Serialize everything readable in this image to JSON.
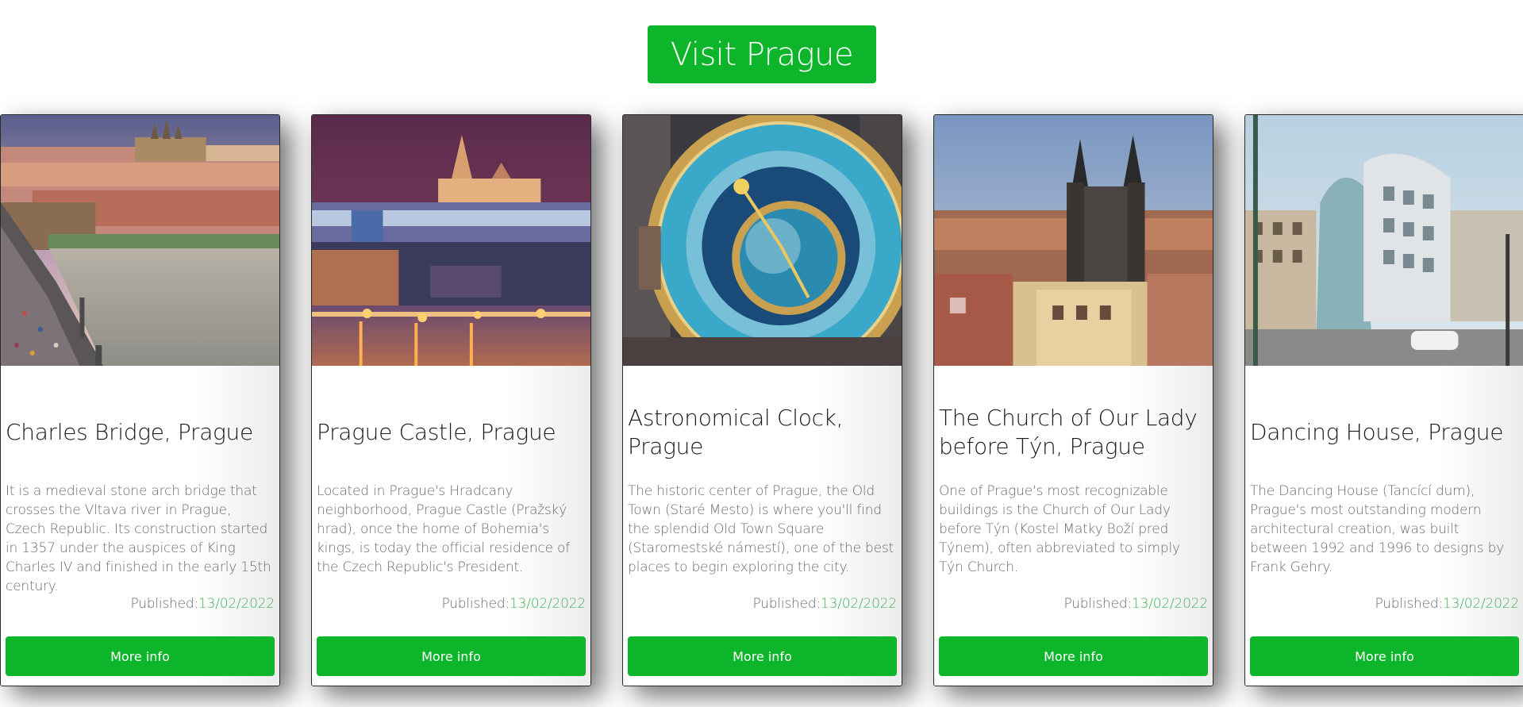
{
  "header": {
    "button_label": "Visit Prague"
  },
  "cards": [
    {
      "image_alt": "Charles Bridge over the Vltava river with Prague Castle skyline",
      "title": "Charles Bridge, Prague",
      "text": "It is a medieval stone arch bridge that crosses the Vltava river in Prague, Czech Republic. Its construction started in 1357 under the auspices of King Charles IV and finished in the early 15th century.",
      "published_label": "Published:",
      "published_date": "13/02/2022",
      "button_label": "More info"
    },
    {
      "image_alt": "Prague Castle illuminated at night above the river",
      "title": "Prague Castle, Prague",
      "text": "Located in Prague's Hradcany neighborhood, Prague Castle (Pražský hrad), once the home of Bohemia's kings, is today the official residence of the Czech Republic's President.",
      "published_label": "Published:",
      "published_date": "13/02/2022",
      "button_label": "More info"
    },
    {
      "image_alt": "Prague Astronomical Clock dial",
      "title": "Astronomical Clock, Prague",
      "text": "The historic center of Prague, the Old Town (Staré Mesto) is where you'll find the splendid Old Town Square (Staromestské námestí), one of the best places to begin exploring the city.",
      "published_label": "Published:",
      "published_date": "13/02/2022",
      "button_label": "More info"
    },
    {
      "image_alt": "Church of Our Lady before Týn towering over Old Town rooftops",
      "title": "The Church of Our Lady before Týn, Prague",
      "text": "One of Prague's most recognizable buildings is the Church of Our Lady before Týn (Kostel Matky Boží pred Týnem), often abbreviated to simply Týn Church.",
      "published_label": "Published:",
      "published_date": "13/02/2022",
      "button_label": "More info"
    },
    {
      "image_alt": "Dancing House modern building on a street corner",
      "title": "Dancing House, Prague",
      "text": "The Dancing House (Tancící dum), Prague's most outstanding modern architectural creation, was built between 1992 and 1996 to designs by Frank Gehry.",
      "published_label": "Published:",
      "published_date": "13/02/2022",
      "button_label": "More info"
    }
  ],
  "colors": {
    "accent": "#0db52a",
    "date": "#3fb458",
    "body_text": "#6b6b6b",
    "title_text": "#1a1a1a"
  }
}
